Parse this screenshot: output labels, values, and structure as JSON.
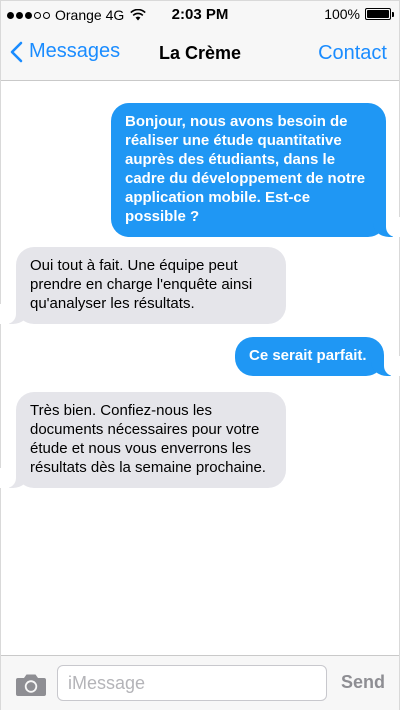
{
  "status_bar": {
    "carrier": "Orange 4G",
    "time": "2:03 PM",
    "battery_percent": "100%",
    "battery_level": 1.0,
    "signal_bars_filled": 3,
    "signal_bars_total": 5
  },
  "nav": {
    "back_label": "Messages",
    "title": "La Crème",
    "right_label": "Contact"
  },
  "messages": [
    {
      "direction": "sent",
      "text": "Bonjour, nous avons besoin de réaliser une étude quantitative auprès des étudiants, dans le cadre du développement de notre application mobile. Est-ce possible ?"
    },
    {
      "direction": "received",
      "text": "Oui tout à fait. Une équipe peut prendre en charge l'enquête ainsi qu'analyser les résultats."
    },
    {
      "direction": "sent",
      "text": "Ce serait parfait."
    },
    {
      "direction": "received",
      "text": "Très bien. Confiez-nous les documents nécessaires pour votre étude et nous vous enverrons les résultats dès la semaine prochaine."
    }
  ],
  "input_bar": {
    "placeholder": "iMessage",
    "value": "",
    "send_label": "Send"
  },
  "colors": {
    "accent": "#1a8cff",
    "sent_bubble": "#1f97f4",
    "received_bubble": "#e5e5ea"
  },
  "icons": {
    "camera": "camera-icon",
    "back": "chevron-left-icon",
    "wifi": "wifi-icon",
    "battery": "battery-icon"
  }
}
